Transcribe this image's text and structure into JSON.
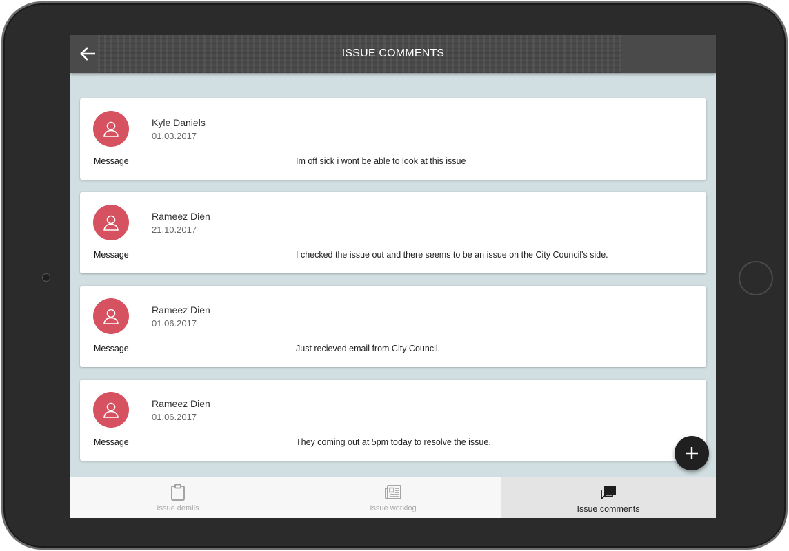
{
  "header": {
    "title": "ISSUE COMMENTS",
    "back_icon": "arrow-left-icon"
  },
  "comments": [
    {
      "author": "Kyle Daniels",
      "date": "01.03.2017",
      "message_label": "Message",
      "message": "Im off sick i wont be able to look at this issue"
    },
    {
      "author": "Rameez Dien",
      "date": "21.10.2017",
      "message_label": "Message",
      "message": "I checked the issue out and there seems to be an issue on the City Council's side."
    },
    {
      "author": "Rameez Dien",
      "date": "01.06.2017",
      "message_label": "Message",
      "message": "Just recieved email from City Council."
    },
    {
      "author": "Rameez Dien",
      "date": "01.06.2017",
      "message_label": "Message",
      "message": "They coming out at 5pm today to resolve the issue."
    }
  ],
  "fab": {
    "icon": "plus-icon"
  },
  "bottom_nav": {
    "items": [
      {
        "label": "Issue details",
        "icon": "clipboard-icon",
        "active": false
      },
      {
        "label": "Issue worklog",
        "icon": "newspaper-icon",
        "active": false
      },
      {
        "label": "Issue comments",
        "icon": "comments-icon",
        "active": true
      }
    ]
  },
  "colors": {
    "app_bar": "#4a4a4a",
    "avatar": "#d65260",
    "screen_background": "#d2dfe2",
    "fab": "#202020"
  }
}
